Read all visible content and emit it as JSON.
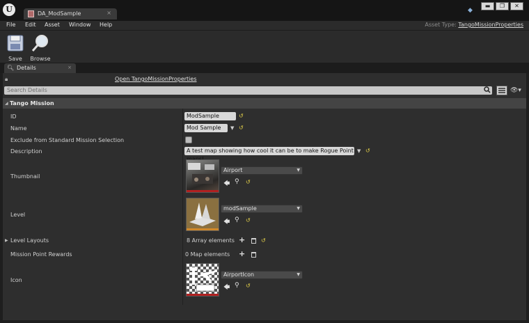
{
  "window": {
    "tab_label": "DA_ModSample",
    "tab_close": "×",
    "min_label": "▬",
    "max_label": "❐",
    "close_label": "✕"
  },
  "menu": [
    "File",
    "Edit",
    "Asset",
    "Window",
    "Help"
  ],
  "asset_type": {
    "label": "Asset Type:",
    "value": "TangoMissionProperties"
  },
  "toolbar": {
    "save_label": "Save",
    "browse_label": "Browse"
  },
  "details_tab": {
    "label": "Details",
    "close": "×"
  },
  "panel": {
    "open_link": "Open TangoMissionProperties",
    "search_placeholder": "Search Details"
  },
  "category": {
    "label": "Tango Mission"
  },
  "properties": {
    "id": {
      "label": "ID",
      "value": "ModSample"
    },
    "name": {
      "label": "Name",
      "value": "Mod Sample"
    },
    "exclude": {
      "label": "Exclude from Standard Mission Selection",
      "checked": false
    },
    "description": {
      "label": "Description",
      "value": "A test map showing how cool it can be to make Rogue Point maps!"
    },
    "thumbnail": {
      "label": "Thumbnail",
      "asset": "Airport"
    },
    "level": {
      "label": "Level",
      "asset": "modSample"
    },
    "level_layouts": {
      "label": "Level Layouts",
      "count_text": "8 Array elements"
    },
    "mission_point_rewards": {
      "label": "Mission Point Rewards",
      "count_text": "0 Map elements"
    },
    "icon": {
      "label": "Icon",
      "asset": "AirportIcon"
    }
  },
  "colors": {
    "reset": "#e8d44a",
    "thumbnail_bar": "#b02020",
    "level_bar": "#d0882a",
    "icon_bar": "#b02020"
  }
}
